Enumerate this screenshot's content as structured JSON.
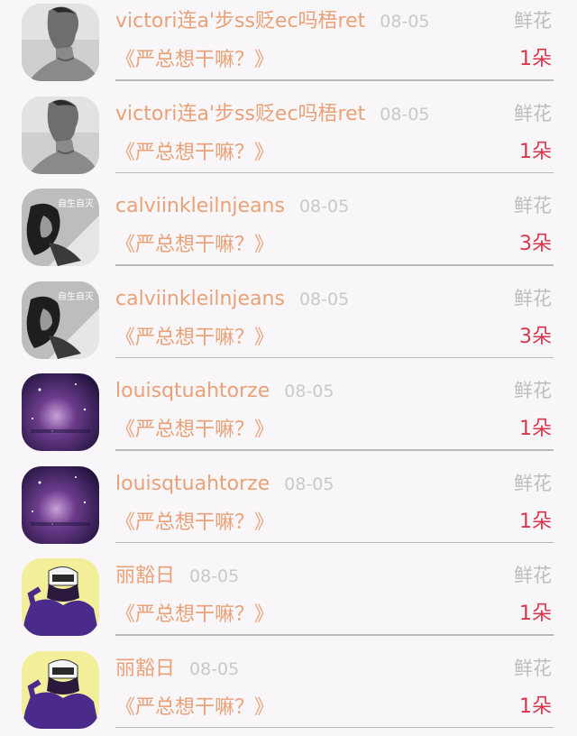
{
  "items": [
    {
      "name": "victori连a'步ss贬ec吗梧ret",
      "date": "08-05",
      "gift_type": "鲜花",
      "title": "《严总想干嘛？》",
      "count": "1朵",
      "avatar_icon": "man-portrait-avatar-icon"
    },
    {
      "name": "victori连a'步ss贬ec吗梧ret",
      "date": "08-05",
      "gift_type": "鲜花",
      "title": "《严总想干嘛？》",
      "count": "1朵",
      "avatar_icon": "man-portrait-avatar-icon"
    },
    {
      "name": "calviinkleilnjeans",
      "date": "08-05",
      "gift_type": "鲜花",
      "title": "《严总想干嘛？》",
      "count": "3朵",
      "avatar_icon": "woman-bw-avatar-icon",
      "avatar_text": "自生自灭"
    },
    {
      "name": "calviinkleilnjeans",
      "date": "08-05",
      "gift_type": "鲜花",
      "title": "《严总想干嘛？》",
      "count": "3朵",
      "avatar_icon": "woman-bw-avatar-icon",
      "avatar_text": "自生自灭"
    },
    {
      "name": "louisqtuahtorze",
      "date": "08-05",
      "gift_type": "鲜花",
      "title": "《严总想干嘛？》",
      "count": "1朵",
      "avatar_icon": "galaxy-avatar-icon"
    },
    {
      "name": "louisqtuahtorze",
      "date": "08-05",
      "gift_type": "鲜花",
      "title": "《严总想干嘛？》",
      "count": "1朵",
      "avatar_icon": "galaxy-avatar-icon"
    },
    {
      "name": "丽豁日",
      "date": "08-05",
      "gift_type": "鲜花",
      "title": "《严总想干嘛？》",
      "count": "1朵",
      "avatar_icon": "girl-cap-avatar-icon"
    },
    {
      "name": "丽豁日",
      "date": "08-05",
      "gift_type": "鲜花",
      "title": "《严总想干嘛？》",
      "count": "1朵",
      "avatar_icon": "girl-cap-avatar-icon"
    }
  ],
  "colors": {
    "name": "#e9a178",
    "title": "#e9a178",
    "date": "#c9c9c9",
    "gift_type": "#bdbdbd",
    "count": "#d9364a",
    "background": "#f8f6f8"
  }
}
